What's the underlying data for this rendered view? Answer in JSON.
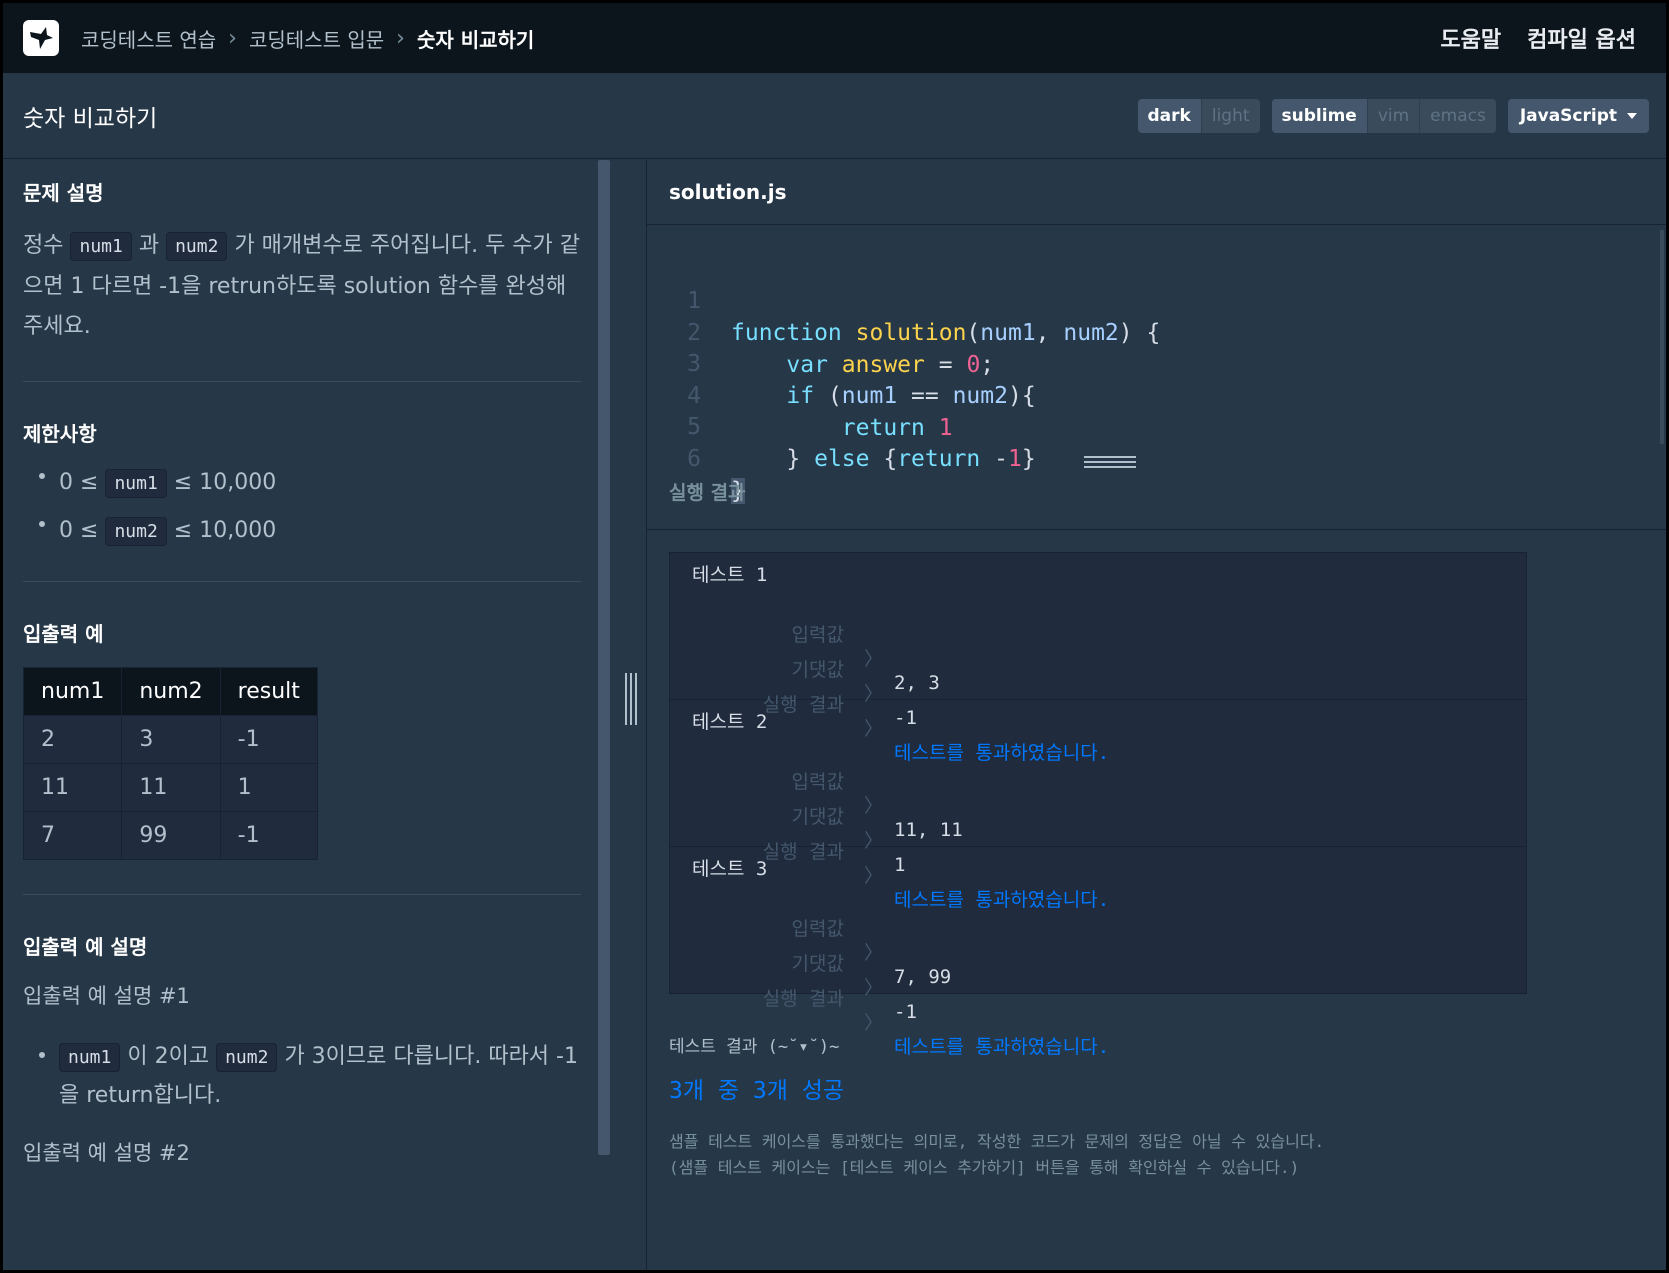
{
  "nav": {
    "breadcrumbs": [
      "코딩테스트 연습",
      "코딩테스트 입문",
      "숫자 비교하기"
    ],
    "help": "도움말",
    "compile_options": "컴파일 옵션"
  },
  "title": "숫자 비교하기",
  "toolbar": {
    "themes": [
      "dark",
      "light"
    ],
    "keymaps": [
      "sublime",
      "vim",
      "emacs"
    ],
    "language": "JavaScript"
  },
  "problem": {
    "desc_heading": "문제 설명",
    "desc_p1": "정수",
    "desc_num1": "num1",
    "desc_p2": "과",
    "desc_num2": "num2",
    "desc_p3": "가 매개변수로 주어집니다. 두 수가 같으면 1 다르면 -1을 retrun하도록 solution 함수를 완성해주세요.",
    "constraints_heading": "제한사항",
    "constraint1_pre": "0 ≤",
    "constraint1_var": "num1",
    "constraint1_post": "≤ 10,000",
    "constraint2_pre": "0 ≤",
    "constraint2_var": "num2",
    "constraint2_post": "≤ 10,000",
    "io_heading": "입출력 예",
    "io_table": {
      "headers": [
        "num1",
        "num2",
        "result"
      ],
      "rows": [
        [
          "2",
          "3",
          "-1"
        ],
        [
          "11",
          "11",
          "1"
        ],
        [
          "7",
          "99",
          "-1"
        ]
      ]
    },
    "io_desc_heading": "입출력 예 설명",
    "io_desc1_heading": "입출력 예 설명 #1",
    "io_desc1_var1": "num1",
    "io_desc1_t1": "이 2이고",
    "io_desc1_var2": "num2",
    "io_desc1_t2": "가 3이므로 다릅니다. 따라서 -1을 return합니다.",
    "io_desc2_heading": "입출력 예 설명 #2"
  },
  "editor": {
    "filename": "solution.js",
    "line_numbers": [
      "1",
      "2",
      "3",
      "4",
      "5",
      "6"
    ],
    "lines": [
      "function solution(num1, num2) {",
      "    var answer = 0;",
      "    if (num1 == num2){",
      "        return 1",
      "    } else {return -1}",
      "}"
    ]
  },
  "result": {
    "heading": "실행 결과",
    "label_input": "입력값",
    "label_expected": "기댓값",
    "label_result": "실행 결과",
    "arrow": "〉",
    "tests": [
      {
        "title": "테스트 1",
        "input": "2, 3",
        "expected": "-1",
        "result": "테스트를 통과하였습니다."
      },
      {
        "title": "테스트 2",
        "input": "11, 11",
        "expected": "1",
        "result": "테스트를 통과하였습니다."
      },
      {
        "title": "테스트 3",
        "input": "7, 99",
        "expected": "-1",
        "result": "테스트를 통과하였습니다."
      }
    ],
    "summary_label": "테스트 결과 (~˘▾˘)~",
    "summary_score": "3개 중 3개 성공",
    "note1": "샘플 테스트 케이스를 통과했다는 의미로, 작성한 코드가 문제의 정답은 아닐 수 있습니다.",
    "note2": "(샘플 테스트 케이스는 [테스트 케이스 추가하기] 버튼을 통해 확인하실 수 있습니다.)"
  },
  "colors": {
    "background": "#263747",
    "nav": "#0c151c",
    "pass": "#0078ff"
  }
}
